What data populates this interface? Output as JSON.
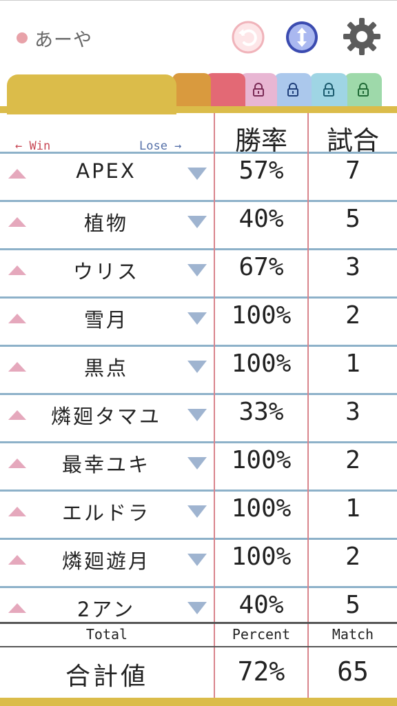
{
  "header": {
    "user_name": "あーや",
    "user_dot_color": "#e8a2a9",
    "undo_icon": "undo-icon",
    "swap_icon": "swap-vertical-icon",
    "settings_icon": "gear-icon"
  },
  "tabs": [
    {
      "color": "#dbbc4a",
      "locked": false
    },
    {
      "color": "#d99a3e",
      "locked": false
    },
    {
      "color": "#e36975",
      "locked": false
    },
    {
      "color": "#e8b6d3",
      "locked": true
    },
    {
      "color": "#abc8ec",
      "locked": true
    },
    {
      "color": "#9fd5e4",
      "locked": true
    },
    {
      "color": "#9ed9aa",
      "locked": true
    }
  ],
  "columns": {
    "win": "← Win",
    "lose": "Lose →",
    "rate": "勝率",
    "match": "試合"
  },
  "rows": [
    {
      "name": "APEX",
      "rate": "57%",
      "match": "7"
    },
    {
      "name": "植物",
      "rate": "40%",
      "match": "5"
    },
    {
      "name": "ウリス",
      "rate": "67%",
      "match": "3"
    },
    {
      "name": "雪月",
      "rate": "100%",
      "match": "2"
    },
    {
      "name": "黒点",
      "rate": "100%",
      "match": "1"
    },
    {
      "name": "燐廻タマユ",
      "rate": "33%",
      "match": "3"
    },
    {
      "name": "最幸ユキ",
      "rate": "100%",
      "match": "2"
    },
    {
      "name": "エルドラ",
      "rate": "100%",
      "match": "1"
    },
    {
      "name": "燐廻遊月",
      "rate": "100%",
      "match": "2"
    },
    {
      "name": "2アン",
      "rate": "40%",
      "match": "5"
    }
  ],
  "footer": {
    "total_label": "Total",
    "percent_label": "Percent",
    "match_label": "Match",
    "total_title": "合計値",
    "total_percent": "72%",
    "total_match": "65"
  }
}
